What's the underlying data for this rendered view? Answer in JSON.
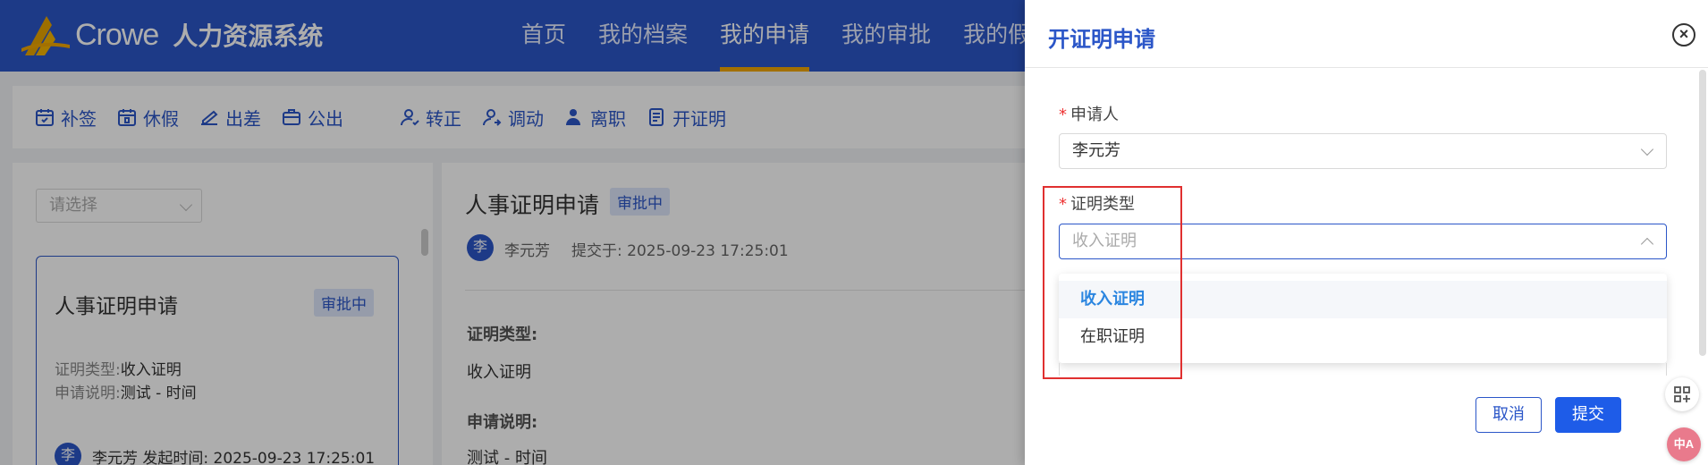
{
  "header": {
    "logo_text": "Crowe",
    "app_name": "人力资源系统",
    "nav": [
      {
        "label": "首页"
      },
      {
        "label": "我的档案"
      },
      {
        "label": "我的申请",
        "active": true
      },
      {
        "label": "我的审批"
      },
      {
        "label": "我的假"
      }
    ]
  },
  "toolbar": {
    "items": [
      {
        "label": "补签",
        "icon": "calendar-check-icon"
      },
      {
        "label": "休假",
        "icon": "calendar-leave-icon"
      },
      {
        "label": "出差",
        "icon": "trip-icon"
      },
      {
        "label": "公出",
        "icon": "briefcase-icon"
      },
      {
        "label": "转正",
        "icon": "user-regular-icon"
      },
      {
        "label": "调动",
        "icon": "user-transfer-icon"
      },
      {
        "label": "离职",
        "icon": "user-leave-icon"
      },
      {
        "label": "开证明",
        "icon": "document-icon"
      }
    ]
  },
  "list_panel": {
    "filter_placeholder": "请选择",
    "card": {
      "title": "人事证明申请",
      "status": "审批中",
      "type_label": "证明类型:",
      "type_value": "收入证明",
      "desc_label": "申请说明:",
      "desc_value": "测试 - 时间",
      "avatar": "李",
      "footer": "李元芳  发起时间: 2025-09-23 17:25:01"
    }
  },
  "detail": {
    "title": "人事证明申请",
    "status": "审批中",
    "avatar": "李",
    "applicant": "李元芳",
    "submitted": "提交于: 2025-09-23 17:25:01",
    "type_label": "证明类型:",
    "type_value": "收入证明",
    "desc_label": "申请说明:",
    "desc_value": "测试 - 时间"
  },
  "drawer": {
    "title": "开证明申请",
    "applicant_label": "申请人",
    "applicant_value": "李元芳",
    "cert_type_label": "证明类型",
    "cert_type_placeholder": "收入证明",
    "options": [
      {
        "label": "收入证明",
        "selected": true
      },
      {
        "label": "在职证明"
      }
    ],
    "cancel_label": "取消",
    "submit_label": "提交",
    "lang_icon_text": "中A"
  },
  "colors": {
    "brand": "#2b56c8",
    "accent": "#f0a500",
    "submit": "#1e5ce8",
    "highlight": "#e03030"
  }
}
